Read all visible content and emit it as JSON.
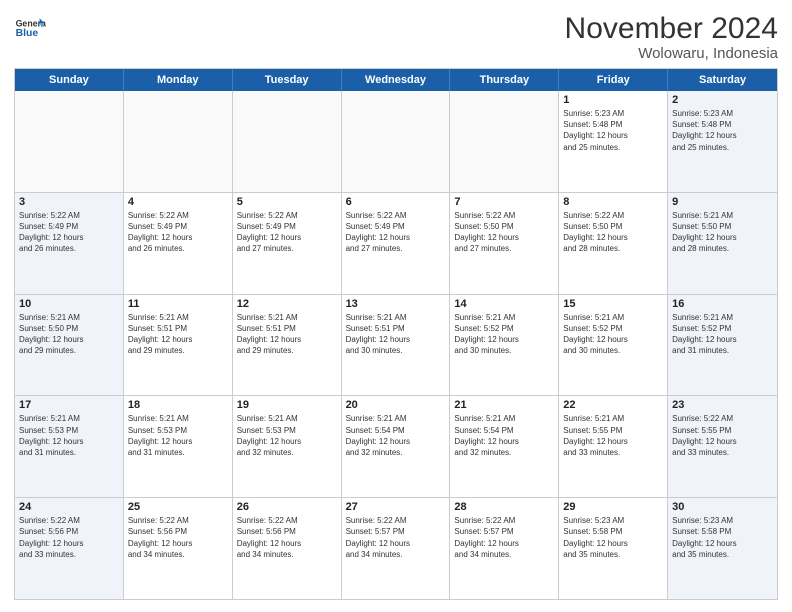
{
  "header": {
    "logo_general": "General",
    "logo_blue": "Blue",
    "month_title": "November 2024",
    "location": "Wolowaru, Indonesia"
  },
  "days_of_week": [
    "Sunday",
    "Monday",
    "Tuesday",
    "Wednesday",
    "Thursday",
    "Friday",
    "Saturday"
  ],
  "weeks": [
    [
      {
        "day": "",
        "info": ""
      },
      {
        "day": "",
        "info": ""
      },
      {
        "day": "",
        "info": ""
      },
      {
        "day": "",
        "info": ""
      },
      {
        "day": "",
        "info": ""
      },
      {
        "day": "1",
        "info": "Sunrise: 5:23 AM\nSunset: 5:48 PM\nDaylight: 12 hours\nand 25 minutes."
      },
      {
        "day": "2",
        "info": "Sunrise: 5:23 AM\nSunset: 5:48 PM\nDaylight: 12 hours\nand 25 minutes."
      }
    ],
    [
      {
        "day": "3",
        "info": "Sunrise: 5:22 AM\nSunset: 5:49 PM\nDaylight: 12 hours\nand 26 minutes."
      },
      {
        "day": "4",
        "info": "Sunrise: 5:22 AM\nSunset: 5:49 PM\nDaylight: 12 hours\nand 26 minutes."
      },
      {
        "day": "5",
        "info": "Sunrise: 5:22 AM\nSunset: 5:49 PM\nDaylight: 12 hours\nand 27 minutes."
      },
      {
        "day": "6",
        "info": "Sunrise: 5:22 AM\nSunset: 5:49 PM\nDaylight: 12 hours\nand 27 minutes."
      },
      {
        "day": "7",
        "info": "Sunrise: 5:22 AM\nSunset: 5:50 PM\nDaylight: 12 hours\nand 27 minutes."
      },
      {
        "day": "8",
        "info": "Sunrise: 5:22 AM\nSunset: 5:50 PM\nDaylight: 12 hours\nand 28 minutes."
      },
      {
        "day": "9",
        "info": "Sunrise: 5:21 AM\nSunset: 5:50 PM\nDaylight: 12 hours\nand 28 minutes."
      }
    ],
    [
      {
        "day": "10",
        "info": "Sunrise: 5:21 AM\nSunset: 5:50 PM\nDaylight: 12 hours\nand 29 minutes."
      },
      {
        "day": "11",
        "info": "Sunrise: 5:21 AM\nSunset: 5:51 PM\nDaylight: 12 hours\nand 29 minutes."
      },
      {
        "day": "12",
        "info": "Sunrise: 5:21 AM\nSunset: 5:51 PM\nDaylight: 12 hours\nand 29 minutes."
      },
      {
        "day": "13",
        "info": "Sunrise: 5:21 AM\nSunset: 5:51 PM\nDaylight: 12 hours\nand 30 minutes."
      },
      {
        "day": "14",
        "info": "Sunrise: 5:21 AM\nSunset: 5:52 PM\nDaylight: 12 hours\nand 30 minutes."
      },
      {
        "day": "15",
        "info": "Sunrise: 5:21 AM\nSunset: 5:52 PM\nDaylight: 12 hours\nand 30 minutes."
      },
      {
        "day": "16",
        "info": "Sunrise: 5:21 AM\nSunset: 5:52 PM\nDaylight: 12 hours\nand 31 minutes."
      }
    ],
    [
      {
        "day": "17",
        "info": "Sunrise: 5:21 AM\nSunset: 5:53 PM\nDaylight: 12 hours\nand 31 minutes."
      },
      {
        "day": "18",
        "info": "Sunrise: 5:21 AM\nSunset: 5:53 PM\nDaylight: 12 hours\nand 31 minutes."
      },
      {
        "day": "19",
        "info": "Sunrise: 5:21 AM\nSunset: 5:53 PM\nDaylight: 12 hours\nand 32 minutes."
      },
      {
        "day": "20",
        "info": "Sunrise: 5:21 AM\nSunset: 5:54 PM\nDaylight: 12 hours\nand 32 minutes."
      },
      {
        "day": "21",
        "info": "Sunrise: 5:21 AM\nSunset: 5:54 PM\nDaylight: 12 hours\nand 32 minutes."
      },
      {
        "day": "22",
        "info": "Sunrise: 5:21 AM\nSunset: 5:55 PM\nDaylight: 12 hours\nand 33 minutes."
      },
      {
        "day": "23",
        "info": "Sunrise: 5:22 AM\nSunset: 5:55 PM\nDaylight: 12 hours\nand 33 minutes."
      }
    ],
    [
      {
        "day": "24",
        "info": "Sunrise: 5:22 AM\nSunset: 5:56 PM\nDaylight: 12 hours\nand 33 minutes."
      },
      {
        "day": "25",
        "info": "Sunrise: 5:22 AM\nSunset: 5:56 PM\nDaylight: 12 hours\nand 34 minutes."
      },
      {
        "day": "26",
        "info": "Sunrise: 5:22 AM\nSunset: 5:56 PM\nDaylight: 12 hours\nand 34 minutes."
      },
      {
        "day": "27",
        "info": "Sunrise: 5:22 AM\nSunset: 5:57 PM\nDaylight: 12 hours\nand 34 minutes."
      },
      {
        "day": "28",
        "info": "Sunrise: 5:22 AM\nSunset: 5:57 PM\nDaylight: 12 hours\nand 34 minutes."
      },
      {
        "day": "29",
        "info": "Sunrise: 5:23 AM\nSunset: 5:58 PM\nDaylight: 12 hours\nand 35 minutes."
      },
      {
        "day": "30",
        "info": "Sunrise: 5:23 AM\nSunset: 5:58 PM\nDaylight: 12 hours\nand 35 minutes."
      }
    ]
  ]
}
